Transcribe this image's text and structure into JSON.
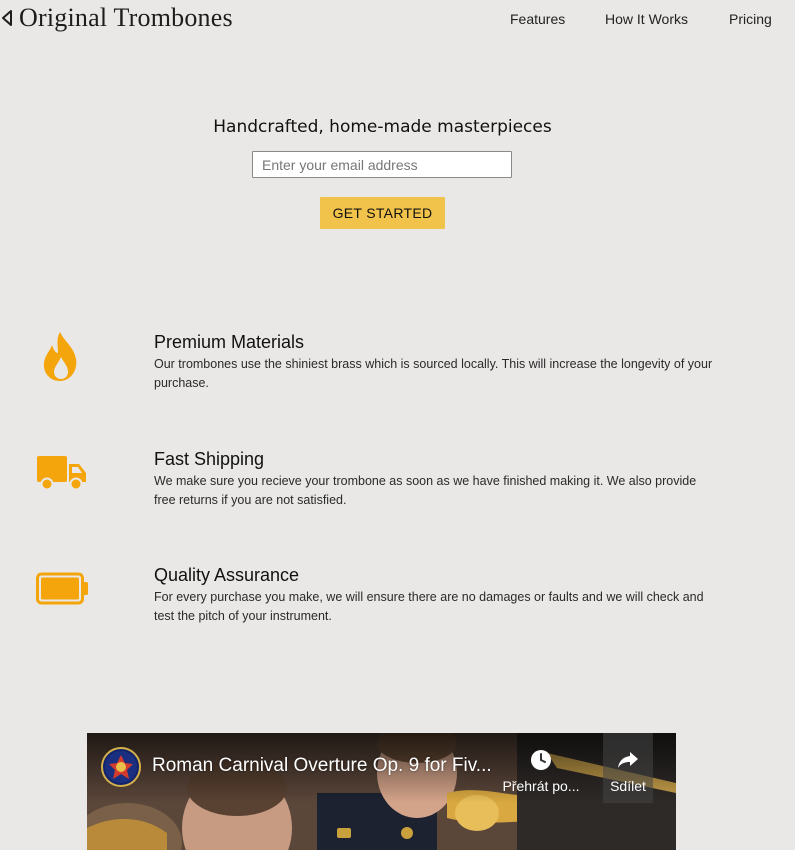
{
  "header": {
    "brand": "Original Trombones",
    "nav": [
      "Features",
      "How It Works",
      "Pricing"
    ]
  },
  "hero": {
    "title": "Handcrafted, home-made masterpieces",
    "email_placeholder": "Enter your email address",
    "cta_label": "GET STARTED"
  },
  "features": [
    {
      "icon": "fire-icon",
      "title": "Premium Materials",
      "text": "Our trombones use the shiniest brass which is sourced locally. This will increase the longevity of your purchase."
    },
    {
      "icon": "truck-icon",
      "title": "Fast Shipping",
      "text": "We make sure you recieve your trombone as soon as we have finished making it. We also provide free returns if you are not satisfied."
    },
    {
      "icon": "battery-icon",
      "title": "Quality Assurance",
      "text": "For every purchase you make, we will ensure there are no damages or faults and we will check and test the pitch of your instrument."
    }
  ],
  "video": {
    "title": "Roman Carnival Overture Op. 9 for Fiv...",
    "watch_later_label": "Přehrát po...",
    "share_label": "Sdílet"
  },
  "colors": {
    "background": "#e9e8e6",
    "accent": "#f1c34a",
    "icon": "#f5a50c"
  }
}
